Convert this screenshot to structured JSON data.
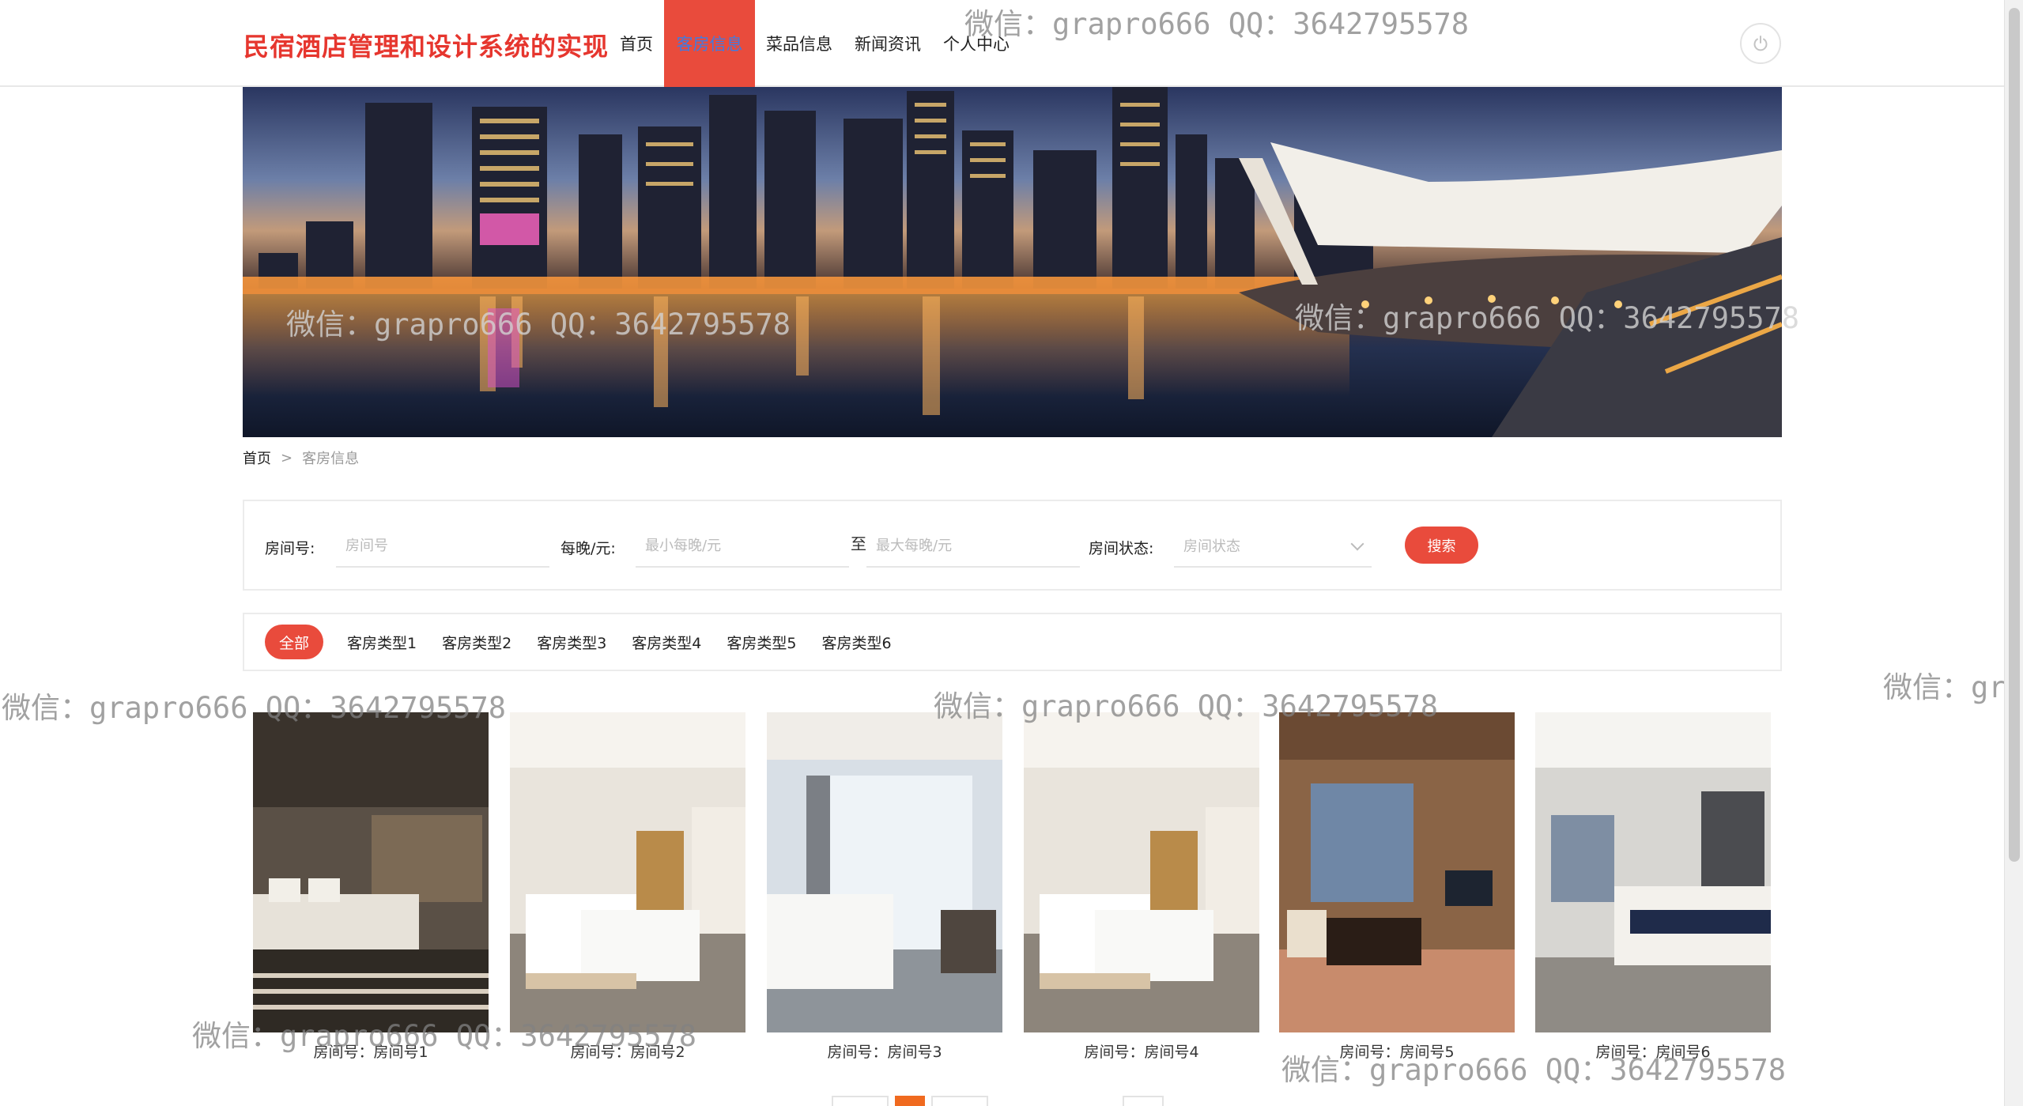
{
  "header": {
    "site_title": "民宿酒店管理和设计系统的实现",
    "nav": [
      {
        "label": "首页"
      },
      {
        "label": "客房信息"
      },
      {
        "label": "菜品信息"
      },
      {
        "label": "新闻资讯"
      },
      {
        "label": "个人中心"
      }
    ],
    "active_nav": "客房信息",
    "power_icon": "power-icon"
  },
  "breadcrumb": {
    "home": "首页",
    "separator": ">",
    "current": "客房信息"
  },
  "search": {
    "room_no_label": "房间号:",
    "room_no_placeholder": "房间号",
    "price_label": "每晚/元:",
    "min_price_placeholder": "最小每晚/元",
    "to_label": "至",
    "max_price_placeholder": "最大每晚/元",
    "status_label": "房间状态:",
    "status_placeholder": "房间状态",
    "search_button": "搜索"
  },
  "types": {
    "all": "全部",
    "items": [
      "客房类型1",
      "客房类型2",
      "客房类型3",
      "客房类型4",
      "客房类型5",
      "客房类型6"
    ]
  },
  "rooms": [
    {
      "caption": "房间号：房间号1"
    },
    {
      "caption": "房间号：房间号2"
    },
    {
      "caption": "房间号：房间号3"
    },
    {
      "caption": "房间号：房间号4"
    },
    {
      "caption": "房间号：房间号5"
    },
    {
      "caption": "房间号：房间号6"
    }
  ],
  "watermark": "微信：grapro666 QQ：3642795578",
  "colors": {
    "brand_red": "#e94b3c",
    "title_red": "#e6362e",
    "active_nav_text": "#3f7be3",
    "pager_active": "#f06a1f"
  }
}
